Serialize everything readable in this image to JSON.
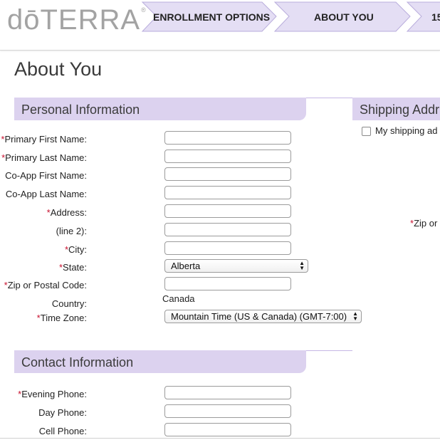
{
  "header": {
    "logo_text": "dōTERRA",
    "logo_mark": "®",
    "steps": [
      {
        "label": "ENROLLMENT OPTIONS"
      },
      {
        "label": "ABOUT YOU"
      },
      {
        "label": "15"
      }
    ]
  },
  "page_title": "About You",
  "personal": {
    "title": "Personal Information",
    "required_mark": "*",
    "fields": {
      "primary_first": {
        "label": "Primary First Name:",
        "required": true,
        "value": ""
      },
      "primary_last": {
        "label": "Primary Last Name:",
        "required": true,
        "value": ""
      },
      "coapp_first": {
        "label": "Co-App First Name:",
        "required": false,
        "value": ""
      },
      "coapp_last": {
        "label": "Co-App Last Name:",
        "required": false,
        "value": ""
      },
      "address": {
        "label": "Address:",
        "required": true,
        "value": ""
      },
      "line2": {
        "label": "(line 2):",
        "required": false,
        "value": ""
      },
      "city": {
        "label": "City:",
        "required": true,
        "value": ""
      },
      "state": {
        "label": "State:",
        "required": true,
        "value": "Alberta"
      },
      "zip": {
        "label": "Zip or Postal Code:",
        "required": true,
        "value": ""
      },
      "country": {
        "label": "Country:",
        "required": false,
        "value": "Canada"
      },
      "timezone": {
        "label": "Time Zone:",
        "required": true,
        "value": "Mountain Time (US & Canada) (GMT-7:00)"
      }
    }
  },
  "contact": {
    "title": "Contact Information",
    "fields": {
      "evening_phone": {
        "label": "Evening Phone:",
        "required": true,
        "value": ""
      },
      "day_phone": {
        "label": "Day Phone:",
        "required": false,
        "value": ""
      },
      "cell_phone": {
        "label": "Cell Phone:",
        "required": false,
        "value": ""
      }
    }
  },
  "shipping": {
    "title": "Shipping Addr",
    "checkbox_label": "My shipping ad",
    "zip_label": "Zip or",
    "required_mark": "*"
  },
  "colors": {
    "section_bg": "#dcd2ef",
    "step_bg": "#e4def4",
    "required": "#c8102e"
  }
}
